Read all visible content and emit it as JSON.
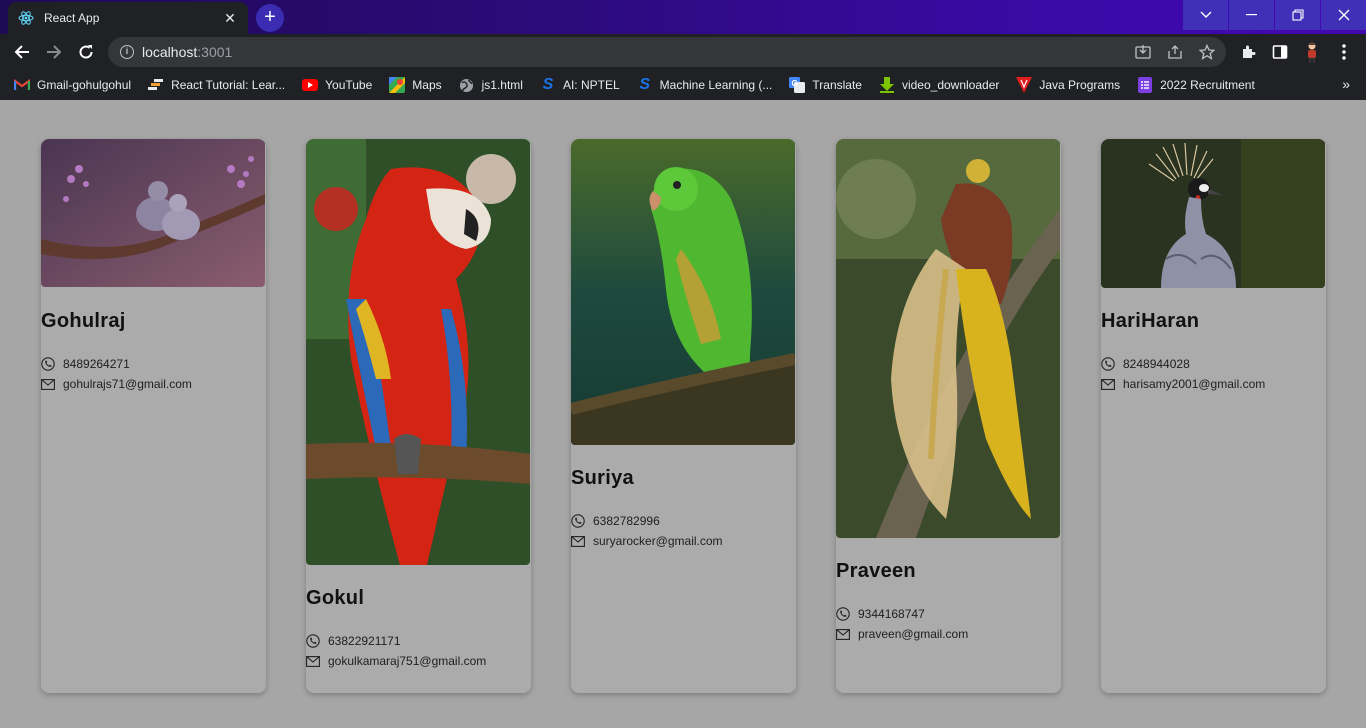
{
  "tab": {
    "title": "React App",
    "close": "✕"
  },
  "newtab": "+",
  "address": {
    "host": "localhost",
    "port": ":3001"
  },
  "bookmarks": [
    {
      "label": "Gmail-gohulgohul",
      "icon": "gmail-icon",
      "color": "#ea4335"
    },
    {
      "label": "React Tutorial: Lear...",
      "icon": "react-tutorial-icon",
      "color": "#f0a030"
    },
    {
      "label": "YouTube",
      "icon": "youtube-icon",
      "color": "#ff0000"
    },
    {
      "label": "Maps",
      "icon": "maps-icon",
      "color": "#34a853"
    },
    {
      "label": "js1.html",
      "icon": "globe-icon",
      "color": "#9aa0a6"
    },
    {
      "label": "AI: NPTEL",
      "icon": "swayam-icon",
      "color": "#1a73e8"
    },
    {
      "label": "Machine Learning (...",
      "icon": "swayam-icon",
      "color": "#1a73e8"
    },
    {
      "label": "Translate",
      "icon": "translate-icon",
      "color": "#4285f4"
    },
    {
      "label": "video_downloader",
      "icon": "download-arrow-icon",
      "color": "#7cc400"
    },
    {
      "label": "Java Programs",
      "icon": "java-v-icon",
      "color": "#e01e1e"
    },
    {
      "label": "2022 Recruitment",
      "icon": "forms-icon",
      "color": "#7b3fe4"
    }
  ],
  "bookmarks_more": "»",
  "cards": [
    {
      "name": "Gohulraj",
      "phone": "8489264271",
      "email": "gohulrajs71@gmail.com",
      "image": "two-birds-on-branch-image"
    },
    {
      "name": "Gokul",
      "phone": "63822921171",
      "email": "gokulkamaraj751@gmail.com",
      "image": "scarlet-macaw-image"
    },
    {
      "name": "Suriya",
      "phone": "6382782996",
      "email": "suryarocker@gmail.com",
      "image": "green-parakeet-image"
    },
    {
      "name": "Praveen",
      "phone": "9344168747",
      "email": "praveen@gmail.com",
      "image": "bird-of-paradise-image"
    },
    {
      "name": "HariHaran",
      "phone": "8248944028",
      "email": "harisamy2001@gmail.com",
      "image": "crowned-crane-image"
    }
  ]
}
